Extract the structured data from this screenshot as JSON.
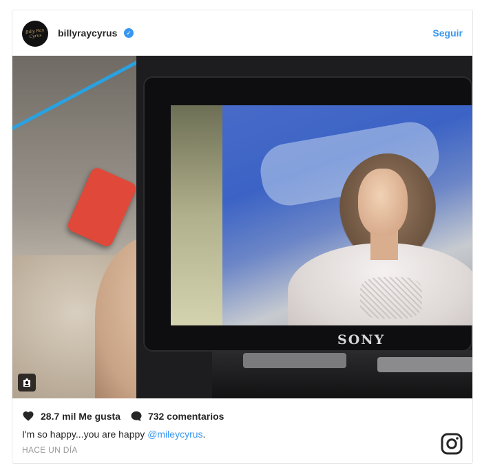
{
  "post": {
    "username": "billyraycyrus",
    "verified": true,
    "avatar_text": "Billy Ray Cyrus",
    "follow_label": "Seguir",
    "photo": {
      "brand_label": "SONY"
    },
    "likes_text": "28.7 mil Me gusta",
    "comments_text": "732 comentarios",
    "caption_text": "I'm so happy...you are happy ",
    "caption_mention": "@mileycyrus",
    "caption_end": ".",
    "timestamp": "HACE UN DÍA"
  },
  "icons": {
    "verified": "verified-badge-icon",
    "heart": "heart-icon",
    "comment": "comment-icon",
    "instagram": "instagram-logo-icon",
    "user_tag": "user-tag-icon"
  },
  "colors": {
    "accent": "#3897f0",
    "text": "#262626",
    "muted": "#999999"
  }
}
